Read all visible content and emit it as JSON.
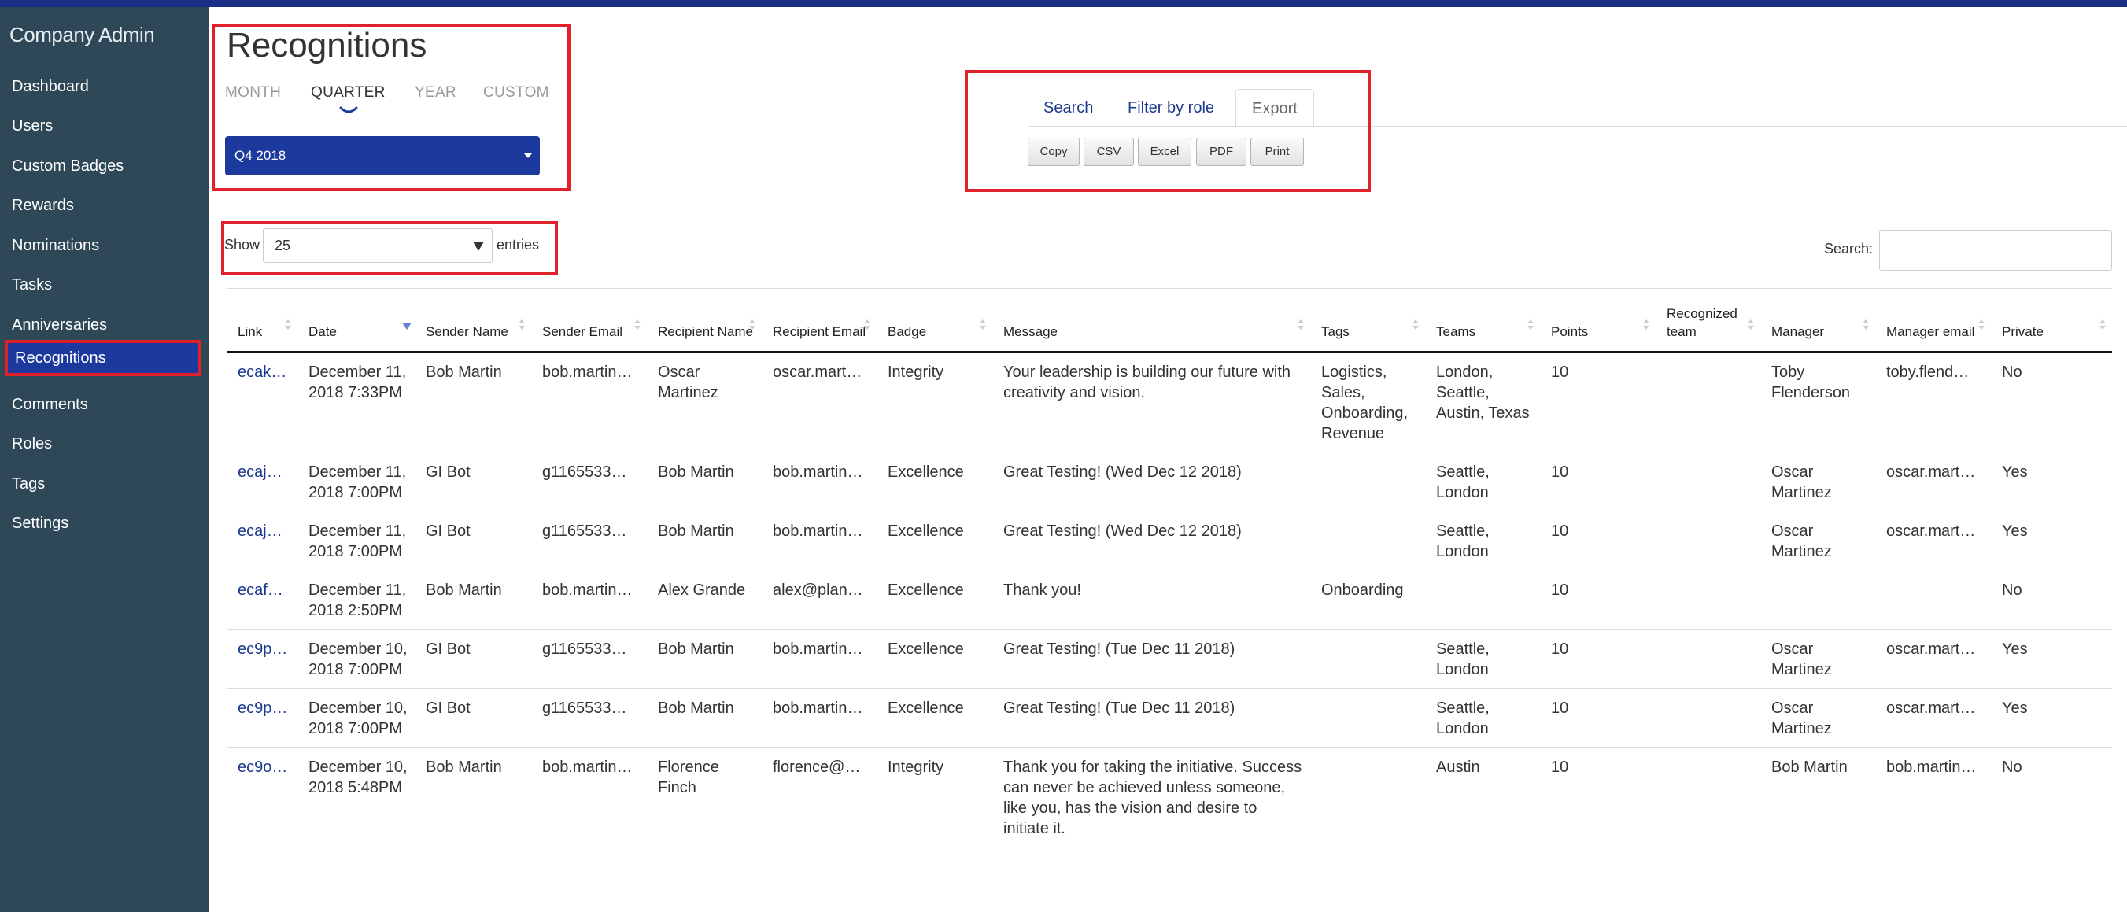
{
  "app": {
    "title": "Company Admin"
  },
  "sidebar": {
    "items": [
      {
        "label": "Dashboard"
      },
      {
        "label": "Users"
      },
      {
        "label": "Custom Badges"
      },
      {
        "label": "Rewards"
      },
      {
        "label": "Nominations"
      },
      {
        "label": "Tasks"
      },
      {
        "label": "Anniversaries"
      },
      {
        "label": "Recognitions",
        "active": true
      },
      {
        "label": "Comments"
      },
      {
        "label": "Roles"
      },
      {
        "label": "Tags"
      },
      {
        "label": "Settings"
      }
    ]
  },
  "page": {
    "title": "Recognitions"
  },
  "period": {
    "tabs": [
      "MONTH",
      "QUARTER",
      "YEAR",
      "CUSTOM"
    ],
    "active": "QUARTER",
    "selected": "Q4 2018"
  },
  "tools": {
    "tabs": [
      "Search",
      "Filter by role",
      "Export"
    ],
    "active": "Export",
    "export_buttons": [
      "Copy",
      "CSV",
      "Excel",
      "PDF",
      "Print"
    ]
  },
  "length": {
    "show_label": "Show",
    "value": "25",
    "entries_label": "entries"
  },
  "search": {
    "label": "Search:",
    "value": ""
  },
  "table": {
    "columns": [
      "Link",
      "Date",
      "Sender Name",
      "Sender Email",
      "Recipient Name",
      "Recipient Email",
      "Badge",
      "Message",
      "Tags",
      "Teams",
      "Points",
      "Recognized team",
      "Manager",
      "Manager email",
      "Private"
    ],
    "sorted_column": "Date",
    "rows": [
      [
        "ecak…",
        "December 11, 2018 7:33PM",
        "Bob Martin",
        "bob.martin…",
        "Oscar Martinez",
        "oscar.mart…",
        "Integrity",
        "Your leadership is building our future with creativity and vision.",
        "Logistics, Sales, Onboarding, Revenue",
        "London, Seattle, Austin, Texas",
        "10",
        "",
        "Toby Flenderson",
        "toby.flend…",
        "No"
      ],
      [
        "ecaj…",
        "December 11, 2018 7:00PM",
        "GI Bot",
        "g1165533…",
        "Bob Martin",
        "bob.martin…",
        "Excellence",
        "Great Testing! (Wed Dec 12 2018)",
        "",
        "Seattle, London",
        "10",
        "",
        "Oscar Martinez",
        "oscar.mart…",
        "Yes"
      ],
      [
        "ecaj…",
        "December 11, 2018 7:00PM",
        "GI Bot",
        "g1165533…",
        "Bob Martin",
        "bob.martin…",
        "Excellence",
        "Great Testing! (Wed Dec 12 2018)",
        "",
        "Seattle, London",
        "10",
        "",
        "Oscar Martinez",
        "oscar.mart…",
        "Yes"
      ],
      [
        "ecaf…",
        "December 11, 2018 2:50PM",
        "Bob Martin",
        "bob.martin…",
        "Alex Grande",
        "alex@plan…",
        "Excellence",
        "Thank you!",
        "Onboarding",
        "",
        "10",
        "",
        "",
        "",
        "No"
      ],
      [
        "ec9p…",
        "December 10, 2018 7:00PM",
        "GI Bot",
        "g1165533…",
        "Bob Martin",
        "bob.martin…",
        "Excellence",
        "Great Testing! (Tue Dec 11 2018)",
        "",
        "Seattle, London",
        "10",
        "",
        "Oscar Martinez",
        "oscar.mart…",
        "Yes"
      ],
      [
        "ec9p…",
        "December 10, 2018 7:00PM",
        "GI Bot",
        "g1165533…",
        "Bob Martin",
        "bob.martin…",
        "Excellence",
        "Great Testing! (Tue Dec 11 2018)",
        "",
        "Seattle, London",
        "10",
        "",
        "Oscar Martinez",
        "oscar.mart…",
        "Yes"
      ],
      [
        "ec9o…",
        "December 10, 2018 5:48PM",
        "Bob Martin",
        "bob.martin…",
        "Florence Finch",
        "florence@…",
        "Integrity",
        "Thank you for taking the initiative. Success can never be achieved unless someone, like you, has the vision and desire to initiate it.",
        "",
        "Austin",
        "10",
        "",
        "Bob Martin",
        "bob.martin…",
        "No"
      ]
    ]
  },
  "colors": {
    "brand": "#1c2f87",
    "sidebar": "#2f4858",
    "accent": "#1c3a9e",
    "highlight": "#e0202a",
    "link": "#1c3a8c"
  }
}
